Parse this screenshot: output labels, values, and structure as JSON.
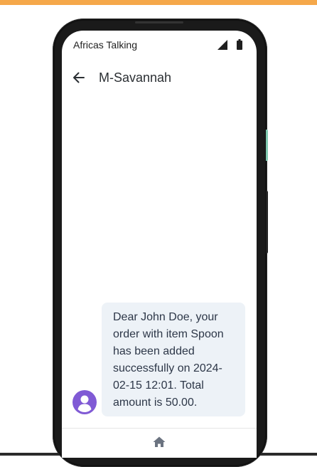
{
  "window": {
    "accent_color": "#f5a84a"
  },
  "status_bar": {
    "carrier": "Africas Talking",
    "signal_icon": "signal-icon",
    "battery_icon": "battery-icon"
  },
  "app_bar": {
    "back_icon": "arrow-left-icon",
    "title": "M-Savannah"
  },
  "messages": [
    {
      "avatar_icon": "user-avatar-icon",
      "avatar_color": "#805ad5",
      "text": "Dear John Doe, your order with item Spoon has been added successfully on 2024-02-15 12:01. Total amount is 50.00."
    }
  ],
  "nav_bar": {
    "home_icon": "home-icon"
  }
}
